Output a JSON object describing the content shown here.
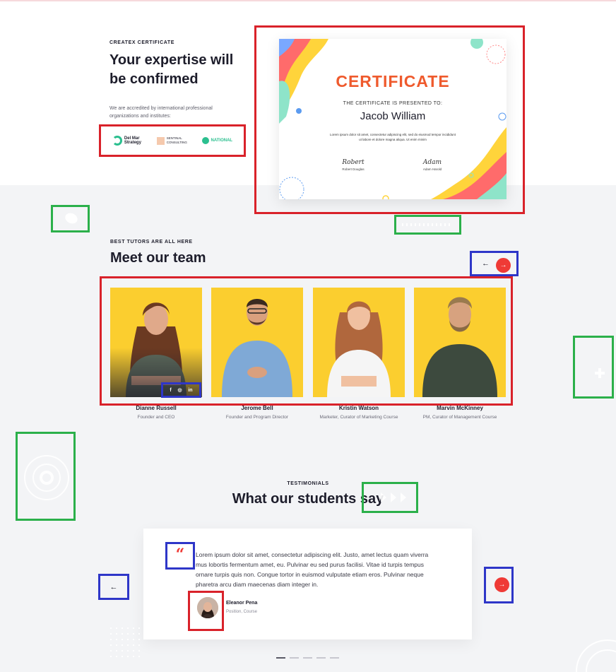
{
  "certificate_section": {
    "eyebrow": "CREATEX CERTIFICATE",
    "title": "Your expertise will be confirmed",
    "description": "We are accredited by international professional organizations and institutes:",
    "partners": [
      {
        "name": "Del Mar Strategy",
        "icon": "del-mar-logo"
      },
      {
        "name": "SENTINAL CONSULTING",
        "icon": "sentinal-logo"
      },
      {
        "name": "NATIONAL",
        "icon": "national-logo"
      }
    ],
    "certificate": {
      "heading": "CERTIFICATE",
      "presented_to": "THE CERTIFICATE IS PRESENTED TO:",
      "recipient": "Jacob William",
      "body": "Lorem ipsum dolor sit amet, consectetur adipiscing elit, sed do eiusmod tempor incididunt ut labore et dolore magna aliqua. Ut enim minim",
      "signatures": [
        {
          "script": "Robert",
          "name": "Robert Douglas"
        },
        {
          "script": "Adam",
          "name": "Adam Harold"
        }
      ]
    }
  },
  "team_section": {
    "eyebrow": "BEST TUTORS ARE ALL HERE",
    "title": "Meet our team",
    "nav": {
      "prev": "←",
      "next": "→"
    },
    "socials": [
      "f",
      "◎",
      "in"
    ],
    "members": [
      {
        "name": "Dianne Russell",
        "role": "Founder and CEO"
      },
      {
        "name": "Jerome Bell",
        "role": "Founder and Program Director"
      },
      {
        "name": "Kristin Watson",
        "role": "Marketer, Curator of Marketing Course"
      },
      {
        "name": "Marvin McKinney",
        "role": "PM, Curator of Management Course"
      }
    ]
  },
  "testimonials_section": {
    "eyebrow": "TESTIMONIALS",
    "title": "What our students say",
    "quote_mark": "“",
    "text": "Lorem ipsum dolor sit amet, consectetur adipiscing elit. Justo, amet lectus quam viverra mus lobortis fermentum amet, eu. Pulvinar eu sed purus facilisi. Vitae id turpis tempus ornare turpis quis non. Congue tortor in euismod vulputate etiam eros. Pulvinar neque pharetra arcu diam maecenas diam integer in.",
    "author": {
      "name": "Eleanor Pena",
      "role": "Position, Course"
    },
    "nav": {
      "prev": "←",
      "next": "→"
    },
    "pager": {
      "count": 5,
      "active": 0
    }
  },
  "colors": {
    "accent": "#ef3a36",
    "certificate_heading": "#ef5a2d",
    "team_bg": "#fbce2f",
    "page_bg": "#f3f4f6"
  }
}
